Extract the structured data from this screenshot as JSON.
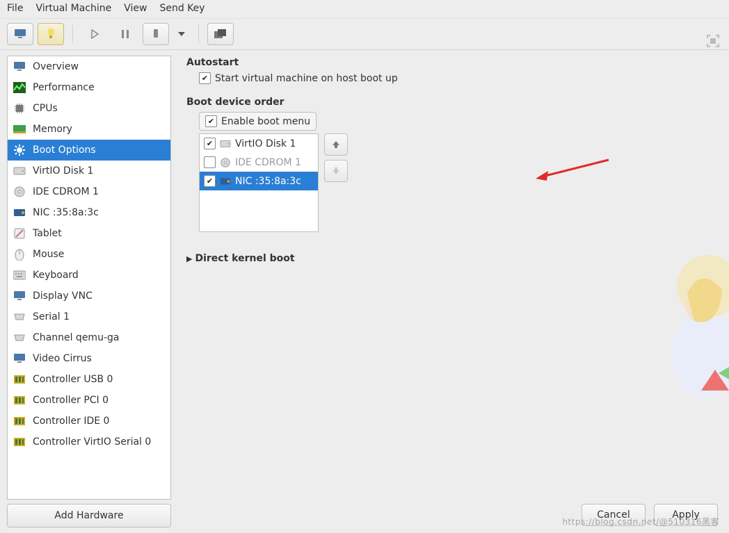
{
  "menu": {
    "file": "File",
    "vm": "Virtual Machine",
    "view": "View",
    "sendkey": "Send Key"
  },
  "sidebar": {
    "items": [
      {
        "label": "Overview",
        "icon": "monitor-icon"
      },
      {
        "label": "Performance",
        "icon": "performance-icon"
      },
      {
        "label": "CPUs",
        "icon": "chip-icon"
      },
      {
        "label": "Memory",
        "icon": "memory-icon"
      },
      {
        "label": "Boot Options",
        "icon": "gear-icon",
        "selected": true
      },
      {
        "label": "VirtIO Disk 1",
        "icon": "disk-icon"
      },
      {
        "label": "IDE CDROM 1",
        "icon": "cd-icon"
      },
      {
        "label": "NIC :35:8a:3c",
        "icon": "nic-icon"
      },
      {
        "label": "Tablet",
        "icon": "tablet-icon"
      },
      {
        "label": "Mouse",
        "icon": "mouse-icon"
      },
      {
        "label": "Keyboard",
        "icon": "keyboard-icon"
      },
      {
        "label": "Display VNC",
        "icon": "monitor-icon"
      },
      {
        "label": "Serial 1",
        "icon": "serial-icon"
      },
      {
        "label": "Channel qemu-ga",
        "icon": "serial-icon"
      },
      {
        "label": "Video Cirrus",
        "icon": "monitor-icon"
      },
      {
        "label": "Controller USB 0",
        "icon": "controller-icon"
      },
      {
        "label": "Controller PCI 0",
        "icon": "controller-icon"
      },
      {
        "label": "Controller IDE 0",
        "icon": "controller-icon"
      },
      {
        "label": "Controller VirtIO Serial 0",
        "icon": "controller-icon"
      }
    ],
    "add_hardware": "Add Hardware"
  },
  "main": {
    "autostart_title": "Autostart",
    "autostart_label": "Start virtual machine on host boot up",
    "autostart_checked": true,
    "boot_order_title": "Boot device order",
    "enable_boot_menu_label": "Enable boot menu",
    "enable_boot_menu_checked": true,
    "boot_devices": [
      {
        "label": "VirtIO Disk 1",
        "checked": true,
        "icon": "disk-icon",
        "selected": false,
        "enabled": true
      },
      {
        "label": "IDE CDROM 1",
        "checked": false,
        "icon": "cd-icon",
        "selected": false,
        "enabled": false
      },
      {
        "label": "NIC :35:8a:3c",
        "checked": true,
        "icon": "nic-icon",
        "selected": true,
        "enabled": true
      }
    ],
    "direct_kernel_label": "Direct kernel boot"
  },
  "footer": {
    "cancel": "Cancel",
    "apply": "Apply"
  },
  "watermark": "https://blog.csdn.net/@510316黑客"
}
